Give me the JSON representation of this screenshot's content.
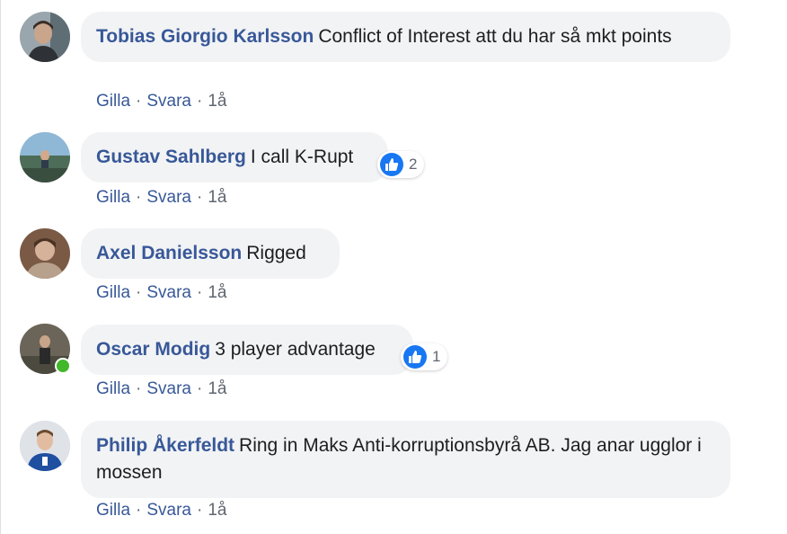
{
  "colors": {
    "author": "#385898",
    "bubble": "#f2f3f5",
    "meta": "#606770",
    "like": "#1877f2",
    "online": "#42b72a"
  },
  "comments": [
    {
      "author": "Tobias Giorgio Karlsson",
      "text": "Conflict of Interest att du har så mkt points",
      "actions": {
        "like": "Gilla",
        "reply": "Svara",
        "age": "1å"
      }
    },
    {
      "author": "Gustav Sahlberg",
      "text": "I call K-Rupt",
      "reaction": {
        "icon": "like-icon",
        "count": "2"
      },
      "actions": {
        "like": "Gilla",
        "reply": "Svara",
        "age": "1å"
      }
    },
    {
      "author": "Axel Danielsson",
      "text": "Rigged",
      "actions": {
        "like": "Gilla",
        "reply": "Svara",
        "age": "1å"
      }
    },
    {
      "author": "Oscar Modig",
      "text": "3 player advantage",
      "online": true,
      "reaction": {
        "icon": "like-icon",
        "count": "1"
      },
      "actions": {
        "like": "Gilla",
        "reply": "Svara",
        "age": "1å"
      }
    },
    {
      "author": "Philip Åkerfeldt",
      "text": "Ring in Maks Anti-korruptionsbyrå AB. Jag anar ugglor i mossen",
      "actions": {
        "like": "Gilla",
        "reply": "Svara",
        "age": "1å"
      }
    }
  ],
  "separator": "·"
}
